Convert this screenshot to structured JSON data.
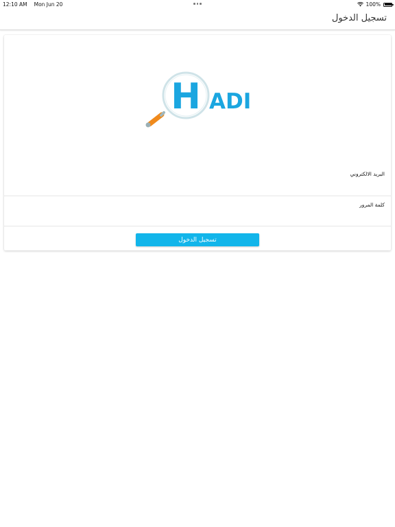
{
  "status_bar": {
    "time": "12:10 AM",
    "date": "Mon Jun 20",
    "battery": "100%"
  },
  "nav": {
    "title": "تسجيل الدخول"
  },
  "logo": {
    "text": "ADI",
    "letter": "H",
    "brand_color": "#1ba6e0",
    "handle_color": "#f08a1c"
  },
  "form": {
    "email_label": "البريد الالكتروني",
    "email_value": "",
    "password_label": "كلمة المرور",
    "password_value": "",
    "login_label": "تسجيل الدخول"
  },
  "colors": {
    "button": "#12b5ea"
  }
}
